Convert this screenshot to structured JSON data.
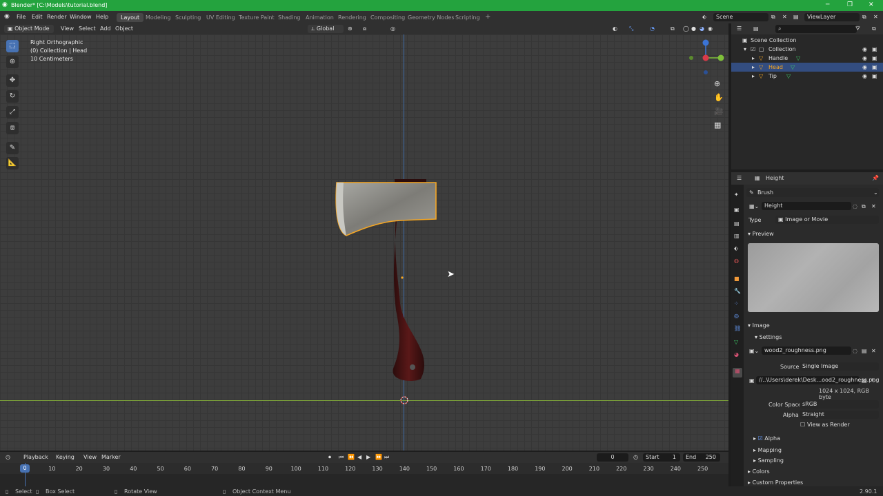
{
  "titlebar": {
    "title": "Blender* [C:\\Models\\tutorial.blend]"
  },
  "menu": [
    "File",
    "Edit",
    "Render",
    "Window",
    "Help"
  ],
  "workspaces": [
    "Layout",
    "Modeling",
    "Sculpting",
    "UV Editing",
    "Texture Paint",
    "Shading",
    "Animation",
    "Rendering",
    "Compositing",
    "Geometry Nodes",
    "Scripting"
  ],
  "scene": {
    "label": "Scene",
    "viewlayer": "ViewLayer"
  },
  "header3d": {
    "mode": "Object Mode",
    "view": "View",
    "select": "Select",
    "add": "Add",
    "object": "Object",
    "orientation": "Global"
  },
  "viewport": {
    "line1": "Right Orthographic",
    "line2": "(0) Collection | Head",
    "line3": "10 Centimeters"
  },
  "outliner": {
    "root": "Scene Collection",
    "collection": "Collection",
    "items": [
      "Handle",
      "Head",
      "Tip"
    ]
  },
  "props": {
    "tex_title": "Height",
    "brush": "Brush",
    "texname": "Height",
    "type_label": "Type",
    "type_value": "Image or Movie",
    "preview": "Preview",
    "image": "Image",
    "settings": "Settings",
    "imgfile": "wood2_roughness.png",
    "source_label": "Source",
    "source_value": "Single Image",
    "path": "//..\\Users\\derek\\Desk...ood2_roughness.png",
    "meta": "1024 x 1024,  RGB byte",
    "cs_label": "Color Space",
    "cs_value": "sRGB",
    "alpha_label": "Alpha",
    "alpha_value": "Straight",
    "view_render": "View as Render",
    "alpha_sect": "Alpha",
    "mapping": "Mapping",
    "sampling": "Sampling",
    "colors": "Colors",
    "custom": "Custom Properties"
  },
  "timeline": {
    "playback": "Playback",
    "keying": "Keying",
    "view": "View",
    "marker": "Marker",
    "frame": "0",
    "start_label": "Start",
    "start": "1",
    "end_label": "End",
    "end": "250",
    "current": "0",
    "ticks": [
      "10",
      "20",
      "30",
      "40",
      "50",
      "60",
      "70",
      "80",
      "90",
      "100",
      "110",
      "120",
      "130",
      "140",
      "150",
      "160",
      "170",
      "180",
      "190",
      "200",
      "210",
      "220",
      "230",
      "240",
      "250"
    ]
  },
  "status": {
    "select": "Select",
    "box": "Box Select",
    "rotate": "Rotate View",
    "context": "Object Context Menu",
    "version": "2.90.1"
  },
  "colors": {
    "title_green": "#24a33e",
    "select_blue": "#4772b3",
    "outline_orange": "#f5a623",
    "handle_red": "#4a1414"
  }
}
